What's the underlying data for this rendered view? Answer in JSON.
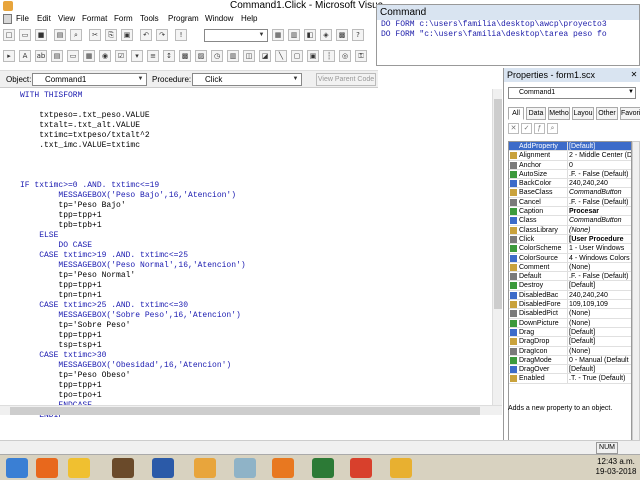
{
  "window": {
    "title": "Command1.Click - Microsoft Visua"
  },
  "menu": [
    "File",
    "Edit",
    "View",
    "Format",
    "Form",
    "Tools",
    "Program",
    "Window",
    "Help"
  ],
  "command_window": {
    "title": "Command",
    "lines": [
      "DO FORM c:\\users\\familia\\desktop\\awcp\\proyecto3",
      "DO FORM \"c:\\users\\familia\\desktop\\tarea peso fo"
    ]
  },
  "object_bar": {
    "object_label": "Object:",
    "object_value": "Command1",
    "procedure_label": "Procedure:",
    "procedure_value": "Click",
    "view_parent_code": "View Parent Code"
  },
  "code": [
    "WITH THISFORM",
    "",
    "    txtpeso=.txt_peso.VALUE",
    "    txtalt=.txt_alt.VALUE",
    "    txtimc=txtpeso/txtalt^2",
    "    .txt_imc.VALUE=txtimc",
    "",
    "",
    "",
    "IF txtimc>=0 .AND. txtimc<=19",
    "        MESSAGEBOX('Peso Bajo',16,'Atencion')",
    "        tp='Peso Bajo'",
    "        tpp=tpp+1",
    "        tpb=tpb+1",
    "    ELSE",
    "        DO CASE",
    "    CASE txtimc>19 .AND. txtimc<=25",
    "        MESSAGEBOX('Peso Normal',16,'Atencion')",
    "        tp='Peso Normal'",
    "        tpp=tpp+1",
    "        tpn=tpn+1",
    "    CASE txtimc>25 .AND. txtimc<=30",
    "        MESSAGEBOX('Sobre Peso',16,'Atencion')",
    "        tp='Sobre Peso'",
    "        tpp=tpp+1",
    "        tsp=tsp+1",
    "    CASE txtimc>30",
    "        MESSAGEBOX('Obesidad',16,'Atencion')",
    "        tp='Peso Obeso'",
    "        tpp=tpp+1",
    "        tpo=tpo+1",
    "        ENDCASE",
    "    ENDIF"
  ],
  "properties": {
    "title": "Properties - form1.scx",
    "object": "Command1",
    "tabs": [
      "All",
      "Data",
      "Metho",
      "Layou",
      "Other",
      "Favorit"
    ],
    "rows": [
      {
        "name": "AddProperty",
        "value": "[Default]",
        "selected": true
      },
      {
        "name": "Alignment",
        "value": "2 - Middle Center (D"
      },
      {
        "name": "Anchor",
        "value": "0"
      },
      {
        "name": "AutoSize",
        "value": ".F. - False (Default)"
      },
      {
        "name": "BackColor",
        "value": "240,240,240"
      },
      {
        "name": "BaseClass",
        "value": "CommandButton"
      },
      {
        "name": "Cancel",
        "value": ".F. - False (Default)"
      },
      {
        "name": "Caption",
        "value": "Procesar"
      },
      {
        "name": "Class",
        "value": "CommandButton"
      },
      {
        "name": "ClassLibrary",
        "value": "(None)"
      },
      {
        "name": "Click",
        "value": "[User Procedure"
      },
      {
        "name": "ColorScheme",
        "value": "1 - User Windows"
      },
      {
        "name": "ColorSource",
        "value": "4 - Windows Colors"
      },
      {
        "name": "Comment",
        "value": "(None)"
      },
      {
        "name": "Default",
        "value": ".F. - False (Default)"
      },
      {
        "name": "Destroy",
        "value": "[Default]"
      },
      {
        "name": "DisabledBac",
        "value": "240,240,240"
      },
      {
        "name": "DisabledFore",
        "value": "109,109,109"
      },
      {
        "name": "DisabledPict",
        "value": "(None)"
      },
      {
        "name": "DownPicture",
        "value": "(None)"
      },
      {
        "name": "Drag",
        "value": "[Default]"
      },
      {
        "name": "DragDrop",
        "value": "[Default]"
      },
      {
        "name": "DragIcon",
        "value": "(None)"
      },
      {
        "name": "DragMode",
        "value": "0 - Manual (Default"
      },
      {
        "name": "DragOver",
        "value": "[Default]"
      },
      {
        "name": "Enabled",
        "value": ".T. - True (Default)"
      }
    ],
    "description": "Adds a new property to an object."
  },
  "status": {
    "num": "NUM"
  },
  "taskbar": {
    "time": "12:43 a.m.",
    "date": "19-03-2018"
  }
}
